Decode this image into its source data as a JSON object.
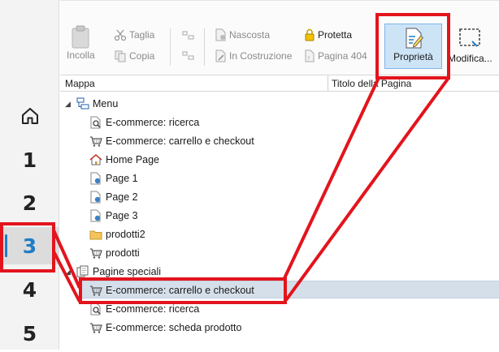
{
  "steps": {
    "items": [
      "1",
      "2",
      "3",
      "4",
      "5"
    ],
    "active": "3"
  },
  "ribbon": {
    "paste_label": "Incolla",
    "cut_label": "Taglia",
    "copy_label": "Copia",
    "hidden_label": "Nascosta",
    "under_construction_label": "In Costruzione",
    "protected_label": "Protetta",
    "page404_label": "Pagina 404",
    "properties_label": "Proprietà",
    "modify_label": "Modifica..."
  },
  "tree": {
    "col_map": "Mappa",
    "col_title": "Titolo della Pagina",
    "groups": [
      {
        "label": "Menu",
        "items": [
          {
            "label": "E-commerce: ricerca",
            "icon": "search-icon"
          },
          {
            "label": "E-commerce: carrello e checkout",
            "icon": "cart-icon"
          },
          {
            "label": "Home Page",
            "icon": "home-icon"
          },
          {
            "label": "Page 1",
            "icon": "page-icon"
          },
          {
            "label": "Page 2",
            "icon": "page-icon"
          },
          {
            "label": "Page 3",
            "icon": "page-icon"
          },
          {
            "label": "prodotti2",
            "icon": "folder-icon"
          },
          {
            "label": "prodotti",
            "icon": "cart-icon"
          }
        ]
      },
      {
        "label": "Pagine speciali",
        "items": [
          {
            "label": "E-commerce: carrello e checkout",
            "icon": "cart-icon",
            "selected": true
          },
          {
            "label": "E-commerce: ricerca",
            "icon": "search-icon"
          },
          {
            "label": "E-commerce: scheda prodotto",
            "icon": "cart-icon"
          }
        ]
      }
    ]
  },
  "colors": {
    "accent": "#1f7dc6",
    "annotation": "#e3141d",
    "selection": "#d5dfea"
  }
}
